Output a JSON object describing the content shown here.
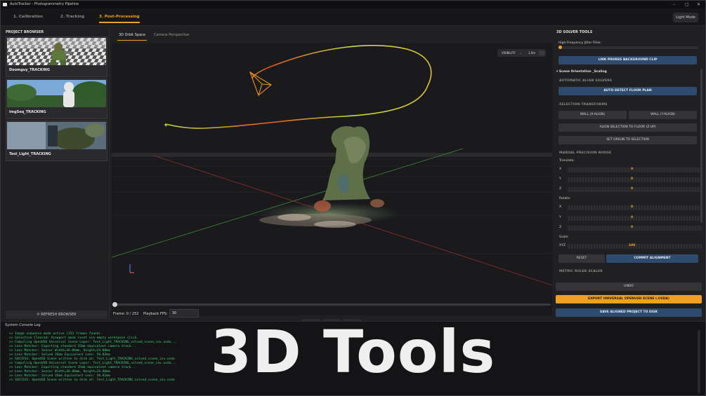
{
  "window": {
    "title": "AutoTracker - Photogrammetry Pipeline",
    "controls": [
      "–",
      "▢",
      "✕"
    ]
  },
  "tabs": [
    {
      "label": "1. Calibration"
    },
    {
      "label": "2. Tracking"
    },
    {
      "label": "3. Post-Processing"
    }
  ],
  "light_mode_label": "Light Mode",
  "project_browser": {
    "title": "PROJECT BROWSER",
    "items": [
      {
        "label": "Doomguy_TRACKING"
      },
      {
        "label": "ImgSeq_TRACKING"
      },
      {
        "label": "Test_Light_TRACKING"
      }
    ],
    "refresh_label": "⟳ REFRESH BROWSER"
  },
  "viewport": {
    "tabs": [
      {
        "label": "3D Orbit Space"
      },
      {
        "label": "Camera Perspective"
      }
    ],
    "visibility_label": "VISIBILITY",
    "visibility_value": "1.0m"
  },
  "playback": {
    "prev": "◂",
    "stop": "■",
    "next": "▸",
    "frames_text": "Frame: 0 / 252",
    "fps_label": "Playback FPS:",
    "fps_value": "30"
  },
  "solver": {
    "title": "3D SOLVER TOOLS",
    "filter_label": "High-Frequency Jitter Filter:",
    "link_button": "LINK PRORES BACKGROUND CLIP",
    "orientation_header": "▾ Scene Orientation _Scaling",
    "auto_align_header": "AUTOMATIC ALIGN SOLVERS",
    "auto_detect_button": "AUTO DETECT FLOOR PLAN",
    "selection_header": "SELECTION TRANSFORMS",
    "wall_x": "WALL (X-ALIGN)",
    "wall_y": "WALL (Y-ALIGN)",
    "align_floor": "ALIGN SELECTION TO FLOOR (Z-UP)",
    "set_origin": "SET ORIGIN TO SELECTION",
    "nudge_header": "MANUAL PRECISION NUDGE",
    "translate_label": "Translate:",
    "rotate_label": "Rotate:",
    "scale_label": "Scale:",
    "translate": [
      {
        "axis": "X",
        "value": "0"
      },
      {
        "axis": "Y",
        "value": "0"
      },
      {
        "axis": "Z",
        "value": "0"
      }
    ],
    "rotate": [
      {
        "axis": "X",
        "value": "0"
      },
      {
        "axis": "Y",
        "value": "0"
      },
      {
        "axis": "Z",
        "value": "0"
      }
    ],
    "scale": {
      "axis": "XYZ",
      "value": "100"
    },
    "reset_button": "RESET",
    "commit_button": "COMMIT ALIGNMENT",
    "ruler_header": "METRIC RULER SCALER",
    "undo_button": "UNDO",
    "export_button": "EXPORT UNIVERSAL OPENUSD SCENE (.USDA)",
    "save_button": "SAVE ALIGNED PROJECT TO DISK"
  },
  "console": {
    "title": "System Console Log",
    "lines": [
      ">> Image sequence mode active (253 frames found).",
      ">> Selection Cleared: Viewport mask reset via empty workspace click.",
      ">> Compiling OpenUSD Universal Scene Layer: Test_Light_TRACKING_solved_scene_inv.usda...",
      ">> Lens Matcher: Exporting standard 35mm equivalent camera track...",
      ">> Lens Matcher: Sensor Width=36.00mm, Height=24.00mm",
      ">> Lens Matcher: Solved 35mm Equivalent Lens: 50.82mm",
      ">> SUCCESS: OpenUSD Scene written to disk at: Test_Light_TRACKING_solved_scene_inv.usda",
      ">> Compiling OpenUSD Universal Scene Layer: Test_Light_TRACKING_solved_scene_inv.usda...",
      ">> Lens Matcher: Exporting standard 35mm equivalent camera track...",
      ">> Lens Matcher: Sensor Width=36.00mm, Height=24.00mm",
      ">> Lens Matcher: Solved 35mm Equivalent Lens: 50.82mm",
      ">> SUCCESS: OpenUSD Scene written to disk at: Test_Light_TRACKING_solved_scene_inv.usda"
    ]
  },
  "overlay_caption": "3D Tools",
  "colors": {
    "accent": "#f0a020",
    "button_blue": "#2e4a6d",
    "console_text": "#3fd27a"
  }
}
